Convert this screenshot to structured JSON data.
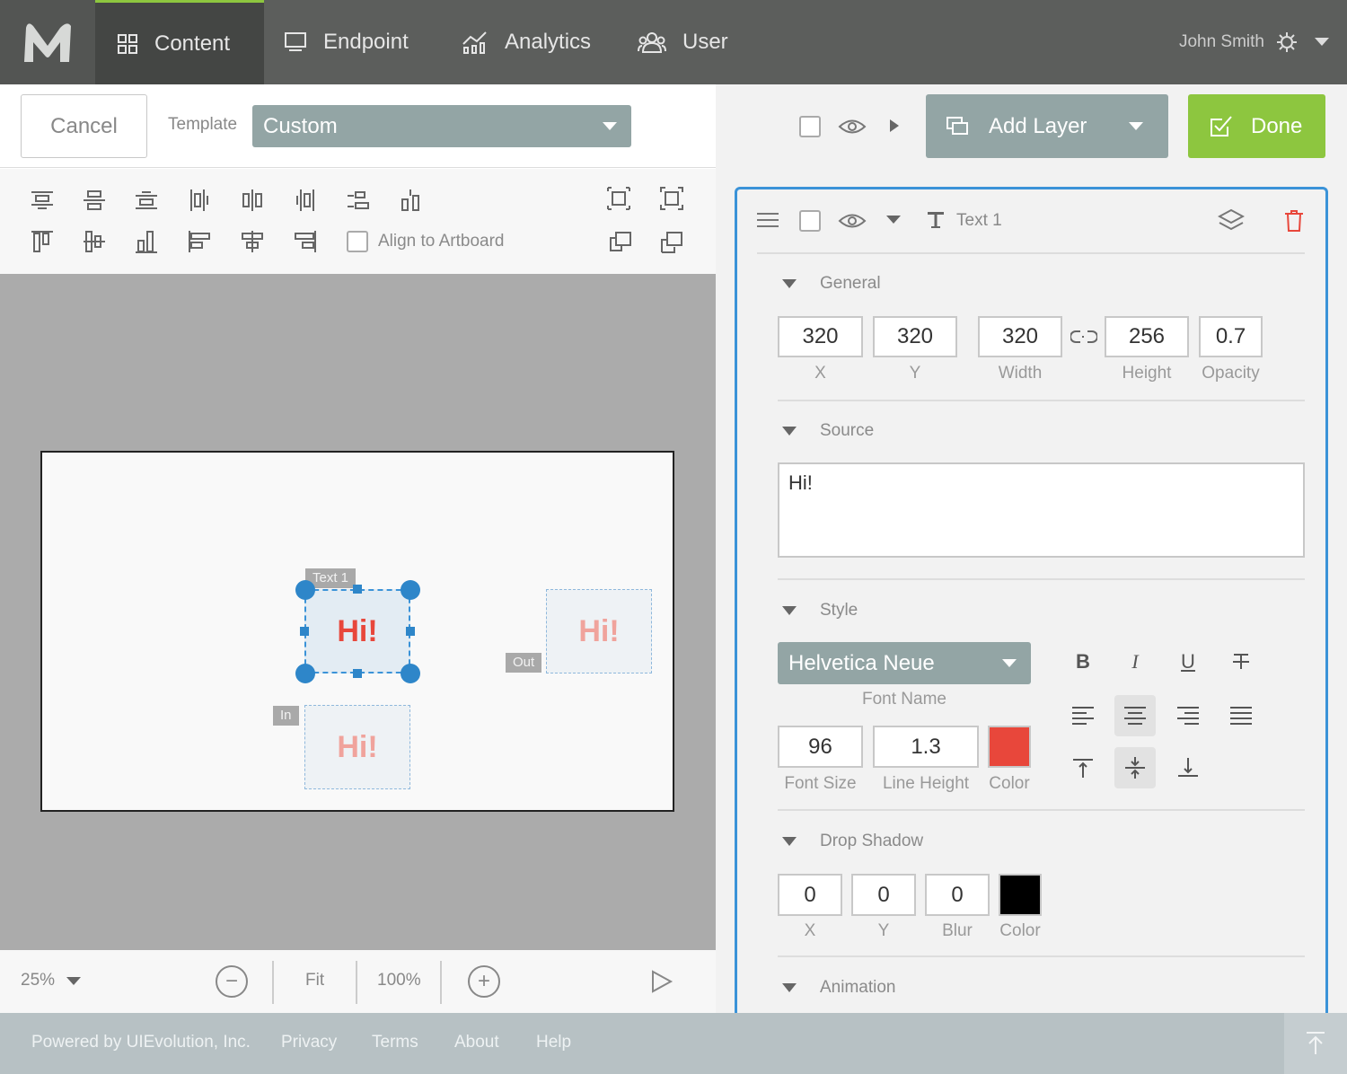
{
  "nav": {
    "items": [
      {
        "label": "Content",
        "icon": "grid-icon"
      },
      {
        "label": "Endpoint",
        "icon": "monitor-icon"
      },
      {
        "label": "Analytics",
        "icon": "chart-icon"
      },
      {
        "label": "User",
        "icon": "users-icon"
      }
    ],
    "user_name": "John Smith",
    "active_color": "#8dc63f"
  },
  "toolbar": {
    "cancel_label": "Cancel",
    "template_label": "Template",
    "template_value": "Custom",
    "add_layer_label": "Add Layer",
    "done_label": "Done",
    "done_color": "#8dc63f"
  },
  "align": {
    "align_to_artboard_label": "Align to Artboard"
  },
  "canvas": {
    "selected_layer_tag": "Text 1",
    "out_tag": "Out",
    "in_tag": "In",
    "text_content": "Hi!",
    "text_color": "#e8473b"
  },
  "bottom": {
    "zoom": "25%",
    "fit_label": "Fit",
    "hundred_label": "100%"
  },
  "layer": {
    "name": "Text 1",
    "general": {
      "title": "General",
      "x": "320",
      "y": "320",
      "width": "320",
      "height": "256",
      "opacity": "0.7",
      "x_label": "X",
      "y_label": "Y",
      "width_label": "Width",
      "height_label": "Height",
      "opacity_label": "Opacity"
    },
    "source": {
      "title": "Source",
      "text": "Hi!"
    },
    "style": {
      "title": "Style",
      "font_name": "Helvetica Neue",
      "font_name_label": "Font Name",
      "font_size": "96",
      "font_size_label": "Font Size",
      "line_height": "1.3",
      "line_height_label": "Line Height",
      "color_label": "Color",
      "color": "#e8473b",
      "bold_glyph": "B",
      "italic_glyph": "I",
      "underline_glyph": "U"
    },
    "drop_shadow": {
      "title": "Drop Shadow",
      "x": "0",
      "y": "0",
      "blur": "0",
      "x_label": "X",
      "y_label": "Y",
      "blur_label": "Blur",
      "color_label": "Color",
      "color": "#000000"
    },
    "animation": {
      "title": "Animation"
    }
  },
  "footer": {
    "powered_by": "Powered by UIEvolution, Inc.",
    "links": [
      "Privacy",
      "Terms",
      "About",
      "Help"
    ]
  }
}
